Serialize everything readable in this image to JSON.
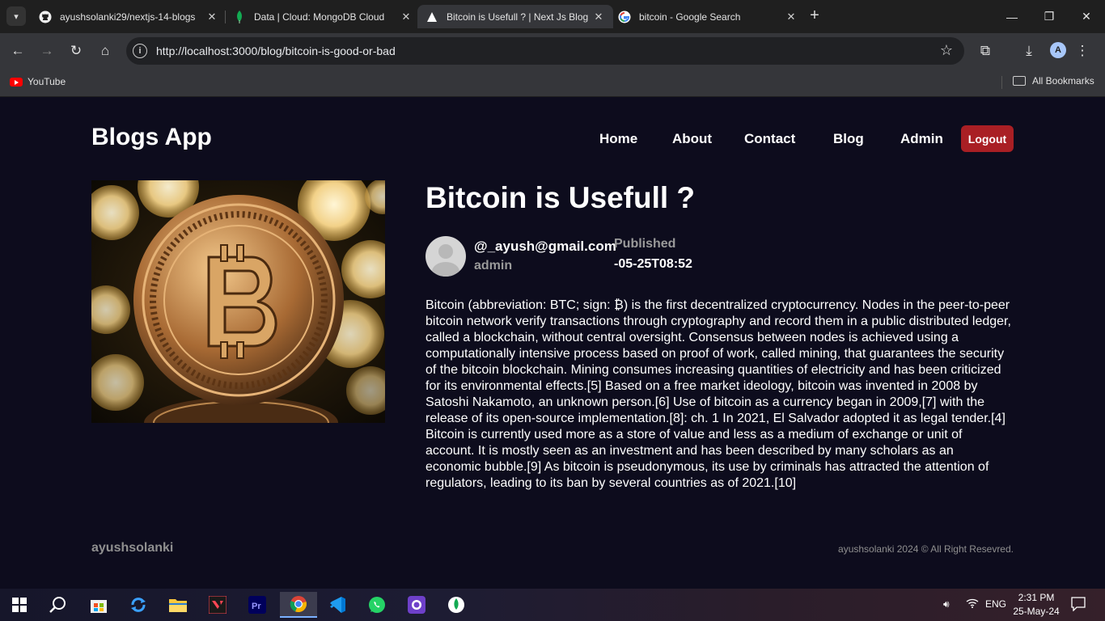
{
  "browser": {
    "tabs": [
      {
        "title": "ayushsolanki29/nextjs-14-blogs",
        "icon": "github-icon"
      },
      {
        "title": "Data | Cloud: MongoDB Cloud",
        "icon": "mongodb-leaf-icon"
      },
      {
        "title": "Bitcoin is Usefull ? | Next Js Blog",
        "icon": "nextjs-triangle-icon",
        "active": true
      },
      {
        "title": "bitcoin - Google Search",
        "icon": "google-icon"
      }
    ],
    "url": "http://localhost:3000/blog/bitcoin-is-good-or-bad",
    "profile_initial": "A",
    "bookmarks": {
      "youtube": "YouTube",
      "all": "All Bookmarks"
    }
  },
  "site": {
    "logo": "Blogs App",
    "nav": [
      "Home",
      "About",
      "Contact",
      "Blog",
      "Admin"
    ],
    "logout": "Logout"
  },
  "post": {
    "title": "Bitcoin is Usefull ?",
    "author_email": "@_ayush@gmail.com",
    "author_role": "admin",
    "published_label": "Published",
    "published_date": "-05-25T08:52",
    "body": "Bitcoin (abbreviation: BTC; sign: ₿) is the first decentralized cryptocurrency. Nodes in the peer-to-peer bitcoin network verify transactions through cryptography and record them in a public distributed ledger, called a blockchain, without central oversight. Consensus between nodes is achieved using a computationally intensive process based on proof of work, called mining, that guarantees the security of the bitcoin blockchain. Mining consumes increasing quantities of electricity and has been criticized for its environmental effects.[5] Based on a free market ideology, bitcoin was invented in 2008 by Satoshi Nakamoto, an unknown person.[6] Use of bitcoin as a currency began in 2009,[7] with the release of its open-source implementation.[8]: ch. 1 In 2021, El Salvador adopted it as legal tender.[4] Bitcoin is currently used more as a store of value and less as a medium of exchange or unit of account. It is mostly seen as an investment and has been described by many scholars as an economic bubble.[9] As bitcoin is pseudonymous, its use by criminals has attracted the attention of regulators, leading to its ban by several countries as of 2021.[10]"
  },
  "footer": {
    "brand": "ayushsolanki",
    "copyright": "ayushsolanki 2024 © All Right Resevred."
  },
  "taskbar": {
    "language": "ENG",
    "time": "2:31 PM",
    "date": "25-May-24"
  },
  "colors": {
    "page_bg": "#0d0c1d",
    "logout_bg": "#a91f24",
    "muted_text": "#9a9a9a"
  }
}
